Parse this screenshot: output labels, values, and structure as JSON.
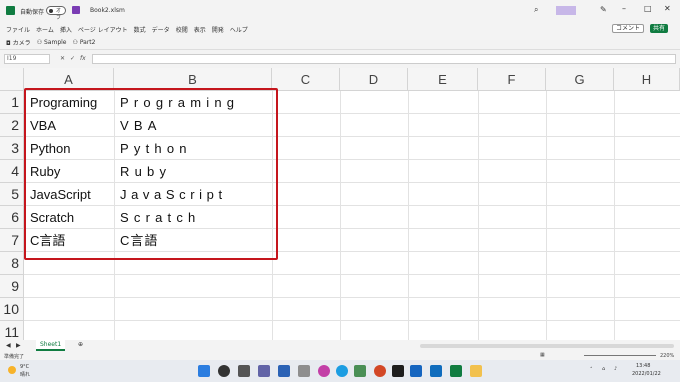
{
  "titlebar": {
    "autosave_label": "自動保存",
    "autosave_state": "オフ",
    "filename": "Book2.xlsm"
  },
  "ribbon_tabs": [
    "ファイル",
    "ホーム",
    "挿入",
    "ページ レイアウト",
    "数式",
    "データ",
    "校閲",
    "表示",
    "開発",
    "ヘルプ"
  ],
  "ribbon_right": {
    "comment": "コメント",
    "share": "共有"
  },
  "toolbar": {
    "camera": "カメラ",
    "sample": "Sample",
    "part2": "Part2"
  },
  "formula": {
    "namebox": "I19",
    "fx": "fx"
  },
  "columns": [
    "A",
    "B",
    "C",
    "D",
    "E",
    "F",
    "G",
    "H"
  ],
  "rows": [
    "1",
    "2",
    "3",
    "4",
    "5",
    "6",
    "7",
    "8",
    "9",
    "10",
    "11"
  ],
  "cells": {
    "a": [
      "Programing",
      "VBA",
      "Python",
      "Ruby",
      "JavaScript",
      "Scratch",
      "C言語"
    ],
    "b": [
      "Programing",
      "VBA",
      "Python",
      "Ruby",
      "JavaScript",
      "Scratch",
      "C言語"
    ]
  },
  "sheet": {
    "tab": "Sheet1"
  },
  "status": {
    "ready": "準備完了",
    "zoom": "220%"
  },
  "taskbar": {
    "temp": "9°C",
    "weather": "晴れ",
    "time": "13:48",
    "date": "2022/01/22"
  },
  "colors": {
    "excel_green": "#107c41",
    "highlight_red": "#c5161d"
  }
}
